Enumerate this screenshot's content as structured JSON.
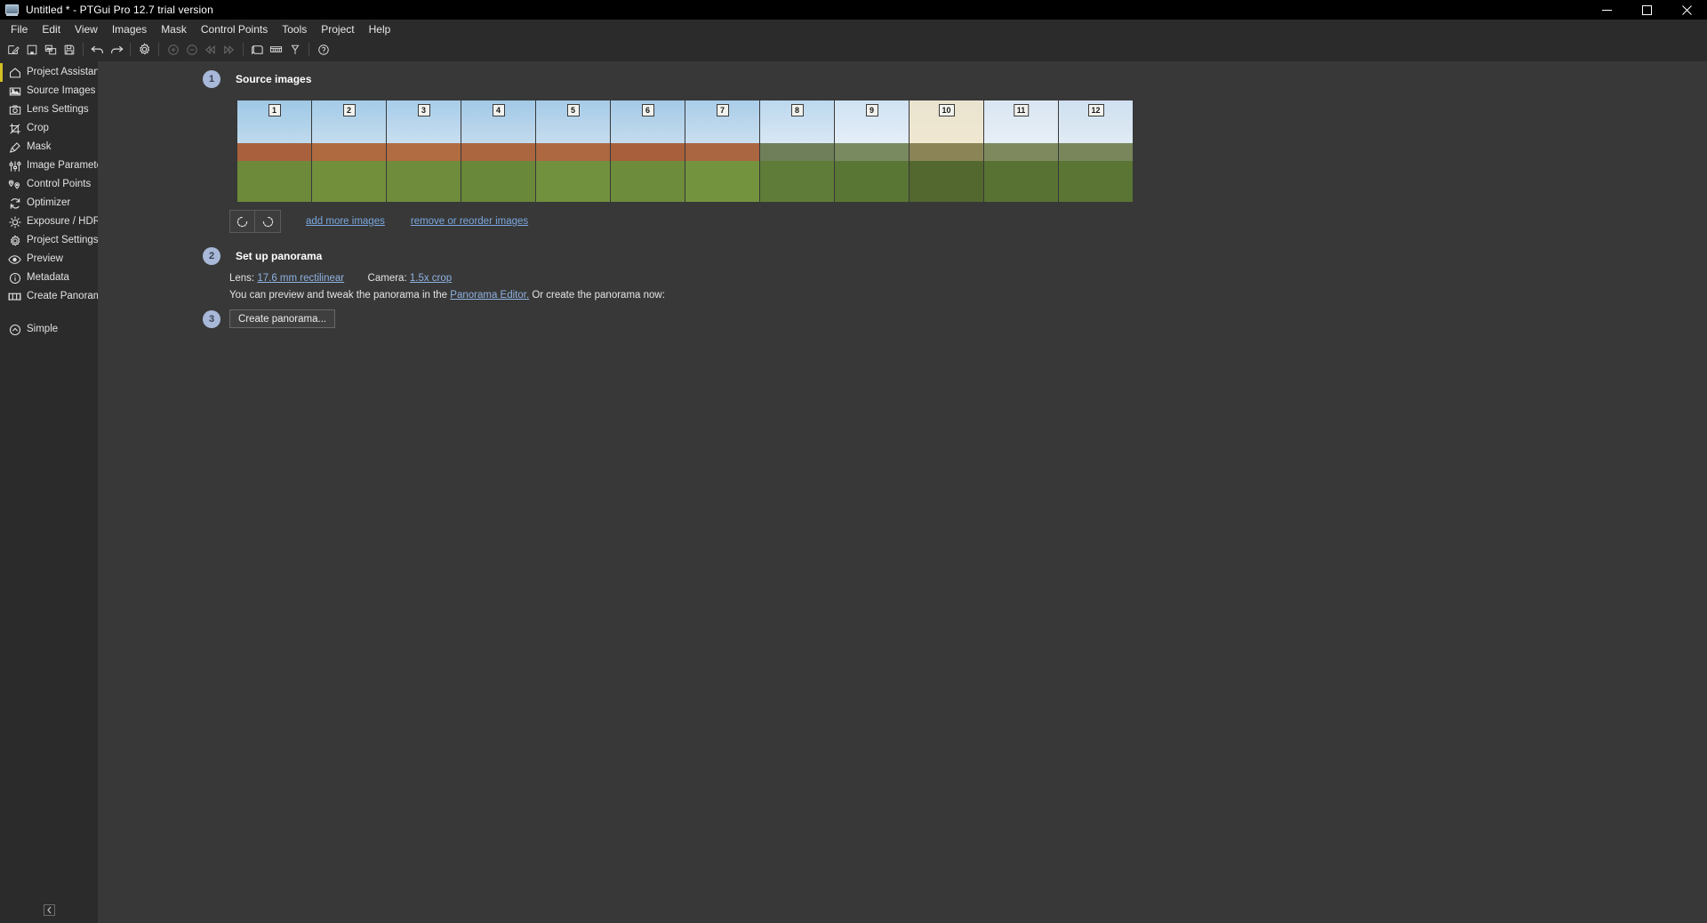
{
  "window": {
    "title": "Untitled * - PTGui Pro 12.7 trial version",
    "icon": "app-window-icon",
    "controls": [
      {
        "name": "minimize",
        "glyph": "minimize-icon"
      },
      {
        "name": "maximize",
        "glyph": "maximize-icon"
      },
      {
        "name": "close",
        "glyph": "close-icon"
      }
    ]
  },
  "menubar": {
    "items": [
      {
        "label": "File"
      },
      {
        "label": "Edit"
      },
      {
        "label": "View"
      },
      {
        "label": "Images"
      },
      {
        "label": "Mask"
      },
      {
        "label": "Control Points"
      },
      {
        "label": "Tools"
      },
      {
        "label": "Project"
      },
      {
        "label": "Help"
      }
    ]
  },
  "toolbar": {
    "buttons": [
      {
        "name": "new-project-icon",
        "enabled": true
      },
      {
        "name": "open-project-icon",
        "enabled": true
      },
      {
        "name": "load-images-icon",
        "enabled": true
      },
      {
        "name": "save-project-icon",
        "enabled": true
      },
      {
        "name": "undo-icon",
        "enabled": true
      },
      {
        "name": "redo-icon",
        "enabled": true
      },
      {
        "name": "settings-gear-icon",
        "enabled": true
      },
      {
        "name": "zoom-in-icon",
        "enabled": false
      },
      {
        "name": "zoom-out-icon",
        "enabled": false
      },
      {
        "name": "rewind-icon",
        "enabled": false
      },
      {
        "name": "fast-forward-icon",
        "enabled": false
      },
      {
        "name": "align-images-icon",
        "enabled": true
      },
      {
        "name": "grid-icon",
        "enabled": true
      },
      {
        "name": "control-point-icon",
        "enabled": true
      },
      {
        "name": "help-circle-icon",
        "enabled": true
      }
    ]
  },
  "sidebar": {
    "items": [
      {
        "label": "Project Assistant",
        "icon": "home-icon",
        "active": true
      },
      {
        "label": "Source Images",
        "icon": "image-icon",
        "active": false
      },
      {
        "label": "Lens Settings",
        "icon": "camera-icon",
        "active": false
      },
      {
        "label": "Crop",
        "icon": "crop-icon",
        "active": false
      },
      {
        "label": "Mask",
        "icon": "brush-icon",
        "active": false
      },
      {
        "label": "Image Parameters",
        "icon": "sliders-icon",
        "active": false
      },
      {
        "label": "Control Points",
        "icon": "pins-icon",
        "active": false
      },
      {
        "label": "Optimizer",
        "icon": "refresh-icon",
        "active": false
      },
      {
        "label": "Exposure / HDR",
        "icon": "sun-icon",
        "active": false
      },
      {
        "label": "Project Settings",
        "icon": "gear-icon",
        "active": false
      },
      {
        "label": "Preview",
        "icon": "eye-icon",
        "active": false
      },
      {
        "label": "Metadata",
        "icon": "info-icon",
        "active": false
      },
      {
        "label": "Create Panorama",
        "icon": "panorama-icon",
        "active": false
      }
    ],
    "mode_toggle": {
      "label": "Simple",
      "icon": "chevron-up-circle-icon"
    },
    "collapse_button": {
      "icon": "chevron-left-icon"
    }
  },
  "main": {
    "step1": {
      "number": "1",
      "title": "Source images"
    },
    "step2": {
      "number": "2",
      "title": "Set up panorama"
    },
    "step3": {
      "number": "3"
    },
    "thumbnails": [
      {
        "number": "1",
        "sky_top": "#9ec8e6",
        "sky_bottom": "#cfe2ef",
        "mid": "#a9603c",
        "ground": "#6c8a3a"
      },
      {
        "number": "2",
        "sky_top": "#a4cbe8",
        "sky_bottom": "#d4e4f0",
        "mid": "#b06a40",
        "ground": "#72903c"
      },
      {
        "number": "3",
        "sky_top": "#a8cdea",
        "sky_bottom": "#d8e6f2",
        "mid": "#b26c42",
        "ground": "#6e8c3c"
      },
      {
        "number": "4",
        "sky_top": "#a2c9e7",
        "sky_bottom": "#d2e2ef",
        "mid": "#ab6640",
        "ground": "#6a883a"
      },
      {
        "number": "5",
        "sky_top": "#a6cbe8",
        "sky_bottom": "#d5e4f0",
        "mid": "#ad6841",
        "ground": "#71913e"
      },
      {
        "number": "6",
        "sky_top": "#a4cae7",
        "sky_bottom": "#d3e3ef",
        "mid": "#a7603b",
        "ground": "#6d8c3c"
      },
      {
        "number": "7",
        "sky_top": "#a9cde9",
        "sky_bottom": "#d9e7f2",
        "mid": "#aa6541",
        "ground": "#73933f"
      },
      {
        "number": "8",
        "sky_top": "#bcd8ee",
        "sky_bottom": "#e6eff7",
        "mid": "#6f7f5a",
        "ground": "#5f7d38"
      },
      {
        "number": "9",
        "sky_top": "#cfe2f2",
        "sky_bottom": "#eef4fa",
        "mid": "#7a8a60",
        "ground": "#5a7634"
      },
      {
        "number": "10",
        "sky_top": "#e8e3cf",
        "sky_bottom": "#f4ead2",
        "mid": "#8a8456",
        "ground": "#53682f"
      },
      {
        "number": "11",
        "sky_top": "#d9e6f2",
        "sky_bottom": "#eef3f8",
        "mid": "#7e8a5e",
        "ground": "#587233"
      },
      {
        "number": "12",
        "sky_top": "#cfe0ef",
        "sky_bottom": "#e8f0f7",
        "mid": "#79865c",
        "ground": "#5a7534"
      }
    ],
    "thumb_tools": {
      "rotate_ccw": "rotate-counterclockwise-icon",
      "rotate_cw": "rotate-clockwise-icon",
      "add_more_images": "add more images",
      "remove_or_reorder": "remove or reorder images"
    },
    "setup": {
      "lens_label": "Lens:",
      "lens_value": "17.6 mm rectilinear",
      "camera_label": "Camera:",
      "camera_value": "1.5x crop",
      "preview_text_before": "You can preview and tweak the panorama in the ",
      "preview_link": "Panorama Editor.",
      "preview_text_after": " Or create the panorama now:"
    },
    "create_button": {
      "label": "Create panorama..."
    }
  },
  "colors": {
    "accent_yellow": "#d4c022",
    "link_blue": "#7aa7dd",
    "badge_blue": "#a8b8d8",
    "panel_bg": "#383838",
    "chrome_bg": "#2b2b2b",
    "titlebar_bg": "#000000"
  }
}
